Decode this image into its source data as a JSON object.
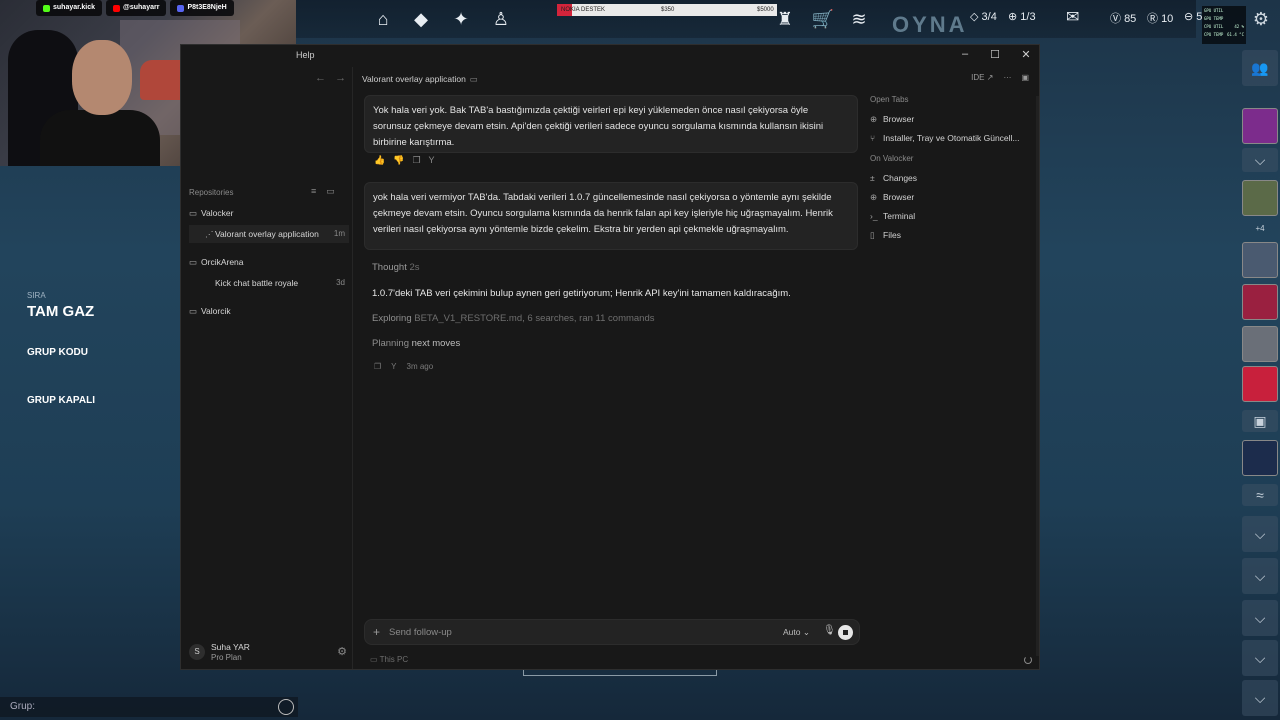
{
  "stream": {
    "socials": [
      {
        "label": "suhayar.kick",
        "color": "#53fc18"
      },
      {
        "label": "@suhayarr",
        "color": "#ff0000"
      },
      {
        "label": "P8t3E8NjeH",
        "color": "#5865f2"
      }
    ]
  },
  "game": {
    "play_label": "OYNA",
    "donation": {
      "label": "NOKIA DESTEK",
      "current": "$350",
      "goal": "$5000",
      "progress": 0.07
    },
    "stats": {
      "party": "3/4",
      "queue": "1/3",
      "vp": "85",
      "rp": "10",
      "extra": "5"
    },
    "perf": [
      {
        "k": "GPU UTIL",
        "v": ""
      },
      {
        "k": "GPU TEMP",
        "v": ""
      },
      {
        "k": "CPU UTIL",
        "v": "42 %"
      },
      {
        "k": "CPU TEMP",
        "v": "61.4 °C"
      }
    ],
    "left_panel": {
      "sira_label": "SIRA",
      "sira_value": "TAM GAZ",
      "grup_kodu": "GRUP KODU",
      "grup_kapali": "GRUP KAPALI",
      "grup_prefix": "Grup:"
    },
    "friend_count_more": "+4"
  },
  "window": {
    "menu_help": "Help",
    "sidebar": {
      "repositories_label": "Repositories",
      "items": [
        {
          "label": "Valocker",
          "type": "folder",
          "time": ""
        },
        {
          "label": "Valorant overlay application",
          "type": "chat",
          "time": "1m"
        },
        {
          "label": "OrcikArena",
          "type": "folder",
          "time": ""
        },
        {
          "label": "Kick chat battle royale",
          "type": "chat",
          "time": "3d"
        },
        {
          "label": "Valorcik",
          "type": "folder",
          "time": ""
        }
      ],
      "user": {
        "initial": "S",
        "name": "Suha YAR",
        "plan": "Pro Plan"
      }
    },
    "main": {
      "tab_title": "Valorant overlay application",
      "ide_label": "IDE ↗",
      "messages": [
        "Yok hala veri yok. Bak TAB'a bastığımızda çektiği veirleri epi keyi yüklemeden önce nasıl çekiyorsa öyle sorunsuz çekmeye devam etsin. Api'den çektiği verileri sadece oyuncu sorgulama kısmında kullansın ikisini birbirine karıştırma.",
        "yok hala veri vermiyor TAB'da. Tabdaki verileri 1.0.7 güncellemesinde nasıl çekiyorsa o yöntemle aynı şekilde çekmeye devam etsin. Oyuncu sorgulama kısmında da henrik falan api key işleriyle hiç uğraşmayalım. Henrik verileri nasıl çekiyorsa aynı yöntemle bizde çekelim.  Ekstra bir yerden api çekmekle uğraşmayalım."
      ],
      "thought_label": "Thought",
      "thought_duration": "2s",
      "answer": "1.0.7'deki TAB veri çekimini bulup aynen geri getiriyorum; Henrik API key'ini tamamen kaldıracağım.",
      "exploring_label": "Exploring",
      "exploring_detail": "BETA_V1_RESTORE.md, 6 searches, ran 11 commands",
      "planning_label": "Planning",
      "planning_detail": "next moves",
      "meta_time": "3m ago",
      "composer_placeholder": "Send follow-up",
      "composer_mode": "Auto",
      "footer_label": "This PC"
    },
    "right_panel": {
      "open_tabs_label": "Open Tabs",
      "open_tabs": [
        {
          "label": "Browser",
          "icon": "globe-icon"
        },
        {
          "label": "Installer, Tray ve Otomatik Güncell...",
          "icon": "branch-icon"
        }
      ],
      "on_label": "On Valocker",
      "on_items": [
        {
          "label": "Changes",
          "icon": "diff-icon"
        },
        {
          "label": "Browser",
          "icon": "globe-icon"
        },
        {
          "label": "Terminal",
          "icon": "terminal-icon"
        },
        {
          "label": "Files",
          "icon": "file-icon"
        }
      ]
    }
  }
}
